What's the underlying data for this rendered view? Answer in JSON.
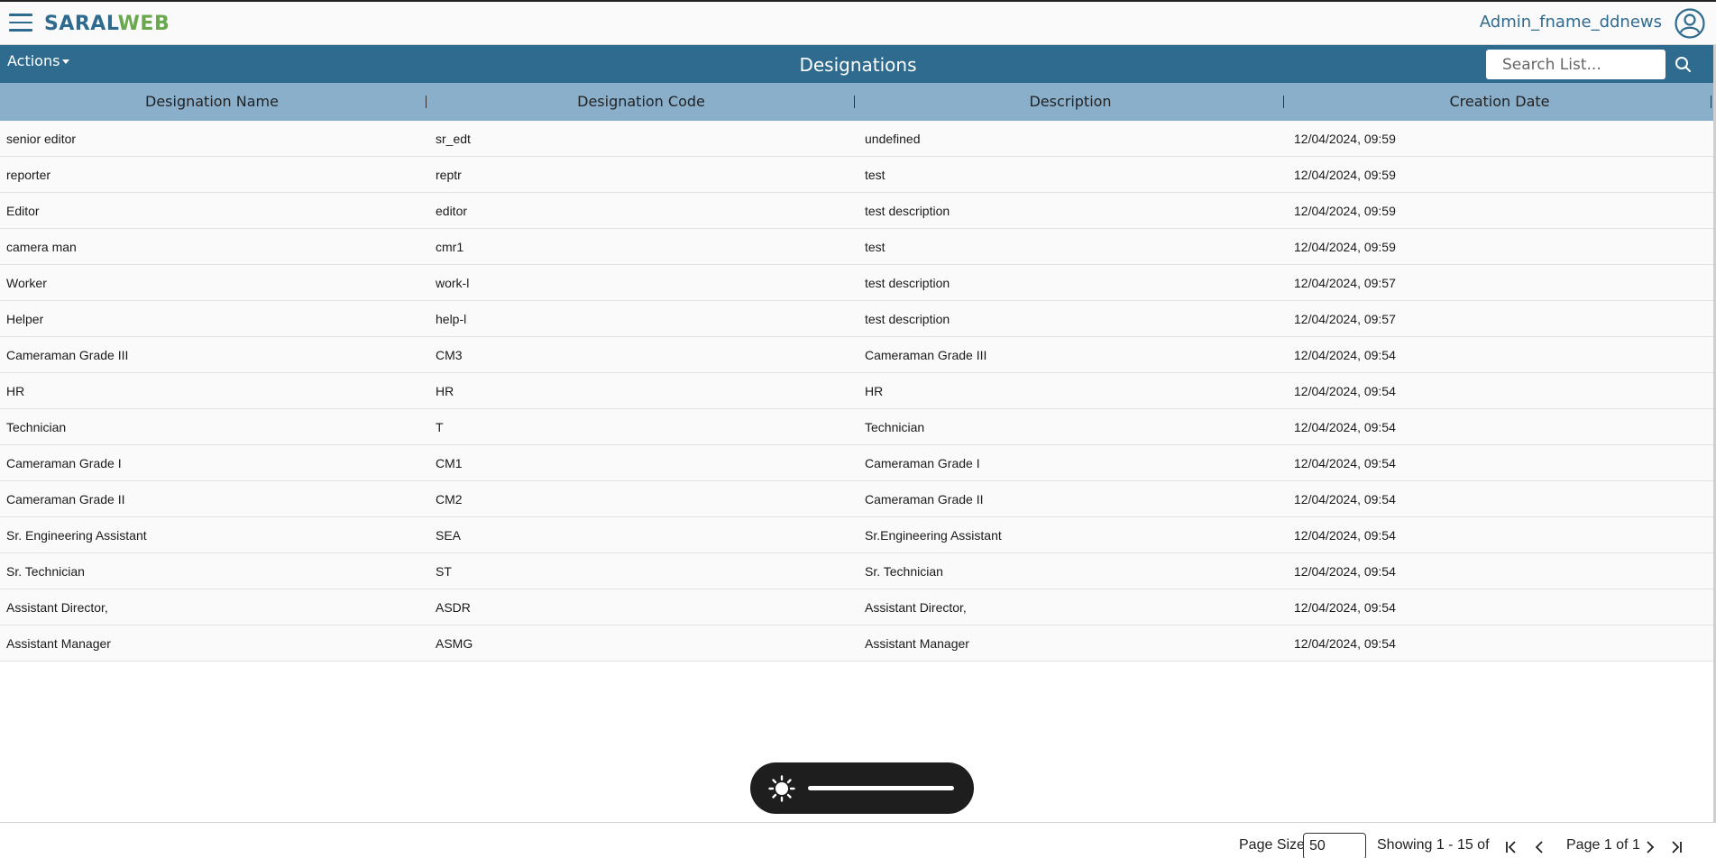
{
  "app": {
    "logo_part1": "SARAL",
    "logo_part2": "WEB",
    "user_name": "Admin_fname_ddnews"
  },
  "toolbar": {
    "actions_label": "Actions",
    "page_title": "Designations",
    "search_placeholder": "Search List..."
  },
  "table": {
    "columns": [
      "Designation Name",
      "Designation Code",
      "Description",
      "Creation Date"
    ],
    "rows": [
      [
        "senior editor",
        "sr_edt",
        "undefined",
        "12/04/2024, 09:59"
      ],
      [
        "reporter",
        "reptr",
        "test",
        "12/04/2024, 09:59"
      ],
      [
        "Editor",
        "editor",
        "test description",
        "12/04/2024, 09:59"
      ],
      [
        "camera man",
        "cmr1",
        "test",
        "12/04/2024, 09:59"
      ],
      [
        "Worker",
        "work-l",
        "test description",
        "12/04/2024, 09:57"
      ],
      [
        "Helper",
        "help-l",
        "test description",
        "12/04/2024, 09:57"
      ],
      [
        "Cameraman Grade III",
        "CM3",
        "Cameraman Grade III",
        "12/04/2024, 09:54"
      ],
      [
        "HR",
        "HR",
        "HR",
        "12/04/2024, 09:54"
      ],
      [
        "Technician",
        "T",
        "Technician",
        "12/04/2024, 09:54"
      ],
      [
        "Cameraman Grade I",
        "CM1",
        "Cameraman Grade I",
        "12/04/2024, 09:54"
      ],
      [
        "Cameraman Grade II",
        "CM2",
        "Cameraman Grade II",
        "12/04/2024, 09:54"
      ],
      [
        "Sr. Engineering Assistant",
        "SEA",
        "Sr.Engineering Assistant",
        "12/04/2024, 09:54"
      ],
      [
        "Sr. Technician",
        "ST",
        "Sr. Technician",
        "12/04/2024, 09:54"
      ],
      [
        "Assistant Director,",
        "ASDR",
        "Assistant Director,",
        "12/04/2024, 09:54"
      ],
      [
        "Assistant Manager",
        "ASMG",
        "Assistant Manager",
        "12/04/2024, 09:54"
      ]
    ]
  },
  "footer": {
    "page_size_label": "Page Size",
    "page_size_value": "50",
    "showing_text": "Showing 1 - 15 of",
    "page_info": "Page 1 of 1"
  },
  "colors": {
    "brand_blue": "#2f6b8f",
    "brand_green": "#6aa84f",
    "header_row": "#8aafcb"
  },
  "icons": [
    "hamburger-menu-icon",
    "user-avatar-icon",
    "search-icon",
    "brightness-sun-icon",
    "first-page-icon",
    "previous-page-icon",
    "next-page-icon",
    "last-page-icon"
  ]
}
